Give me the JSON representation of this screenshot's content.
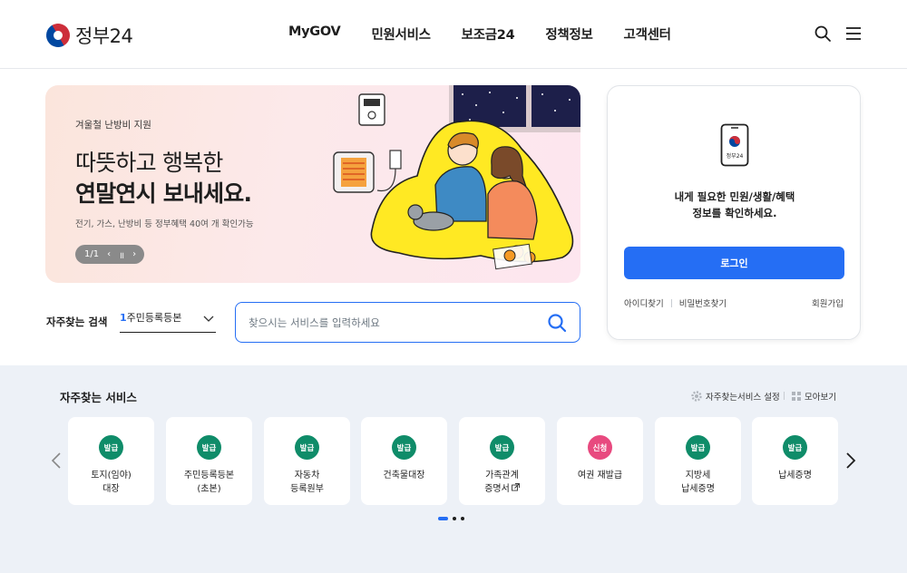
{
  "header": {
    "logo_text": "정부24",
    "nav": [
      "MyGOV",
      "민원서비스",
      "보조금24",
      "정책정보",
      "고객센터"
    ],
    "icons": [
      "search-icon",
      "menu-icon"
    ]
  },
  "banner": {
    "subtitle": "겨울철 난방비 지원",
    "title_line1": "따뜻하고 행복한",
    "title_line2": "연말연시 보내세요.",
    "description": "전기, 가스, 난방비 등 정부혜택 40여 개 확인가능",
    "counter": "1/1",
    "prev": "‹",
    "pause": "॥",
    "next": "›"
  },
  "search": {
    "favorite_label": "자주찾는 검색",
    "favorite_rank": "1",
    "favorite_value": "주민등록등본",
    "placeholder": "찾으시는 서비스를 입력하세요"
  },
  "login": {
    "message_line1": "내게 필요한 민원/생활/혜택",
    "message_line2": "정보를 확인하세요.",
    "phone_label": "정부24",
    "login_button": "로그인",
    "find_id": "아이디찾기",
    "find_password": "비밀번호찾기",
    "signup": "회원가입"
  },
  "services": {
    "title": "자주찾는 서비스",
    "setting_label": "자주찾는서비스 설정",
    "view_all_label": "모아보기",
    "cards": [
      {
        "badge": "발급",
        "line1": "토지(임야)",
        "line2": "대장"
      },
      {
        "badge": "발급",
        "line1": "주민등록등본",
        "line2": "(초본)"
      },
      {
        "badge": "발급",
        "line1": "자동차",
        "line2": "등록원부"
      },
      {
        "badge": "발급",
        "line1": "건축물대장",
        "line2": ""
      },
      {
        "badge": "발급",
        "line1": "가족관계",
        "line2": "증명서"
      },
      {
        "badge": "신청",
        "line1": "여권 재발급",
        "line2": ""
      },
      {
        "badge": "발급",
        "line1": "지방세",
        "line2": "납세증명"
      },
      {
        "badge": "발급",
        "line1": "납세증명",
        "line2": ""
      }
    ],
    "badge_colors": {
      "발급": "#0f8c69",
      "신청": "#e84a7f"
    },
    "pagination": {
      "pages": 3,
      "current": 1
    }
  },
  "colors": {
    "accent": "#256ef4",
    "services_bg": "#edf1f7"
  }
}
